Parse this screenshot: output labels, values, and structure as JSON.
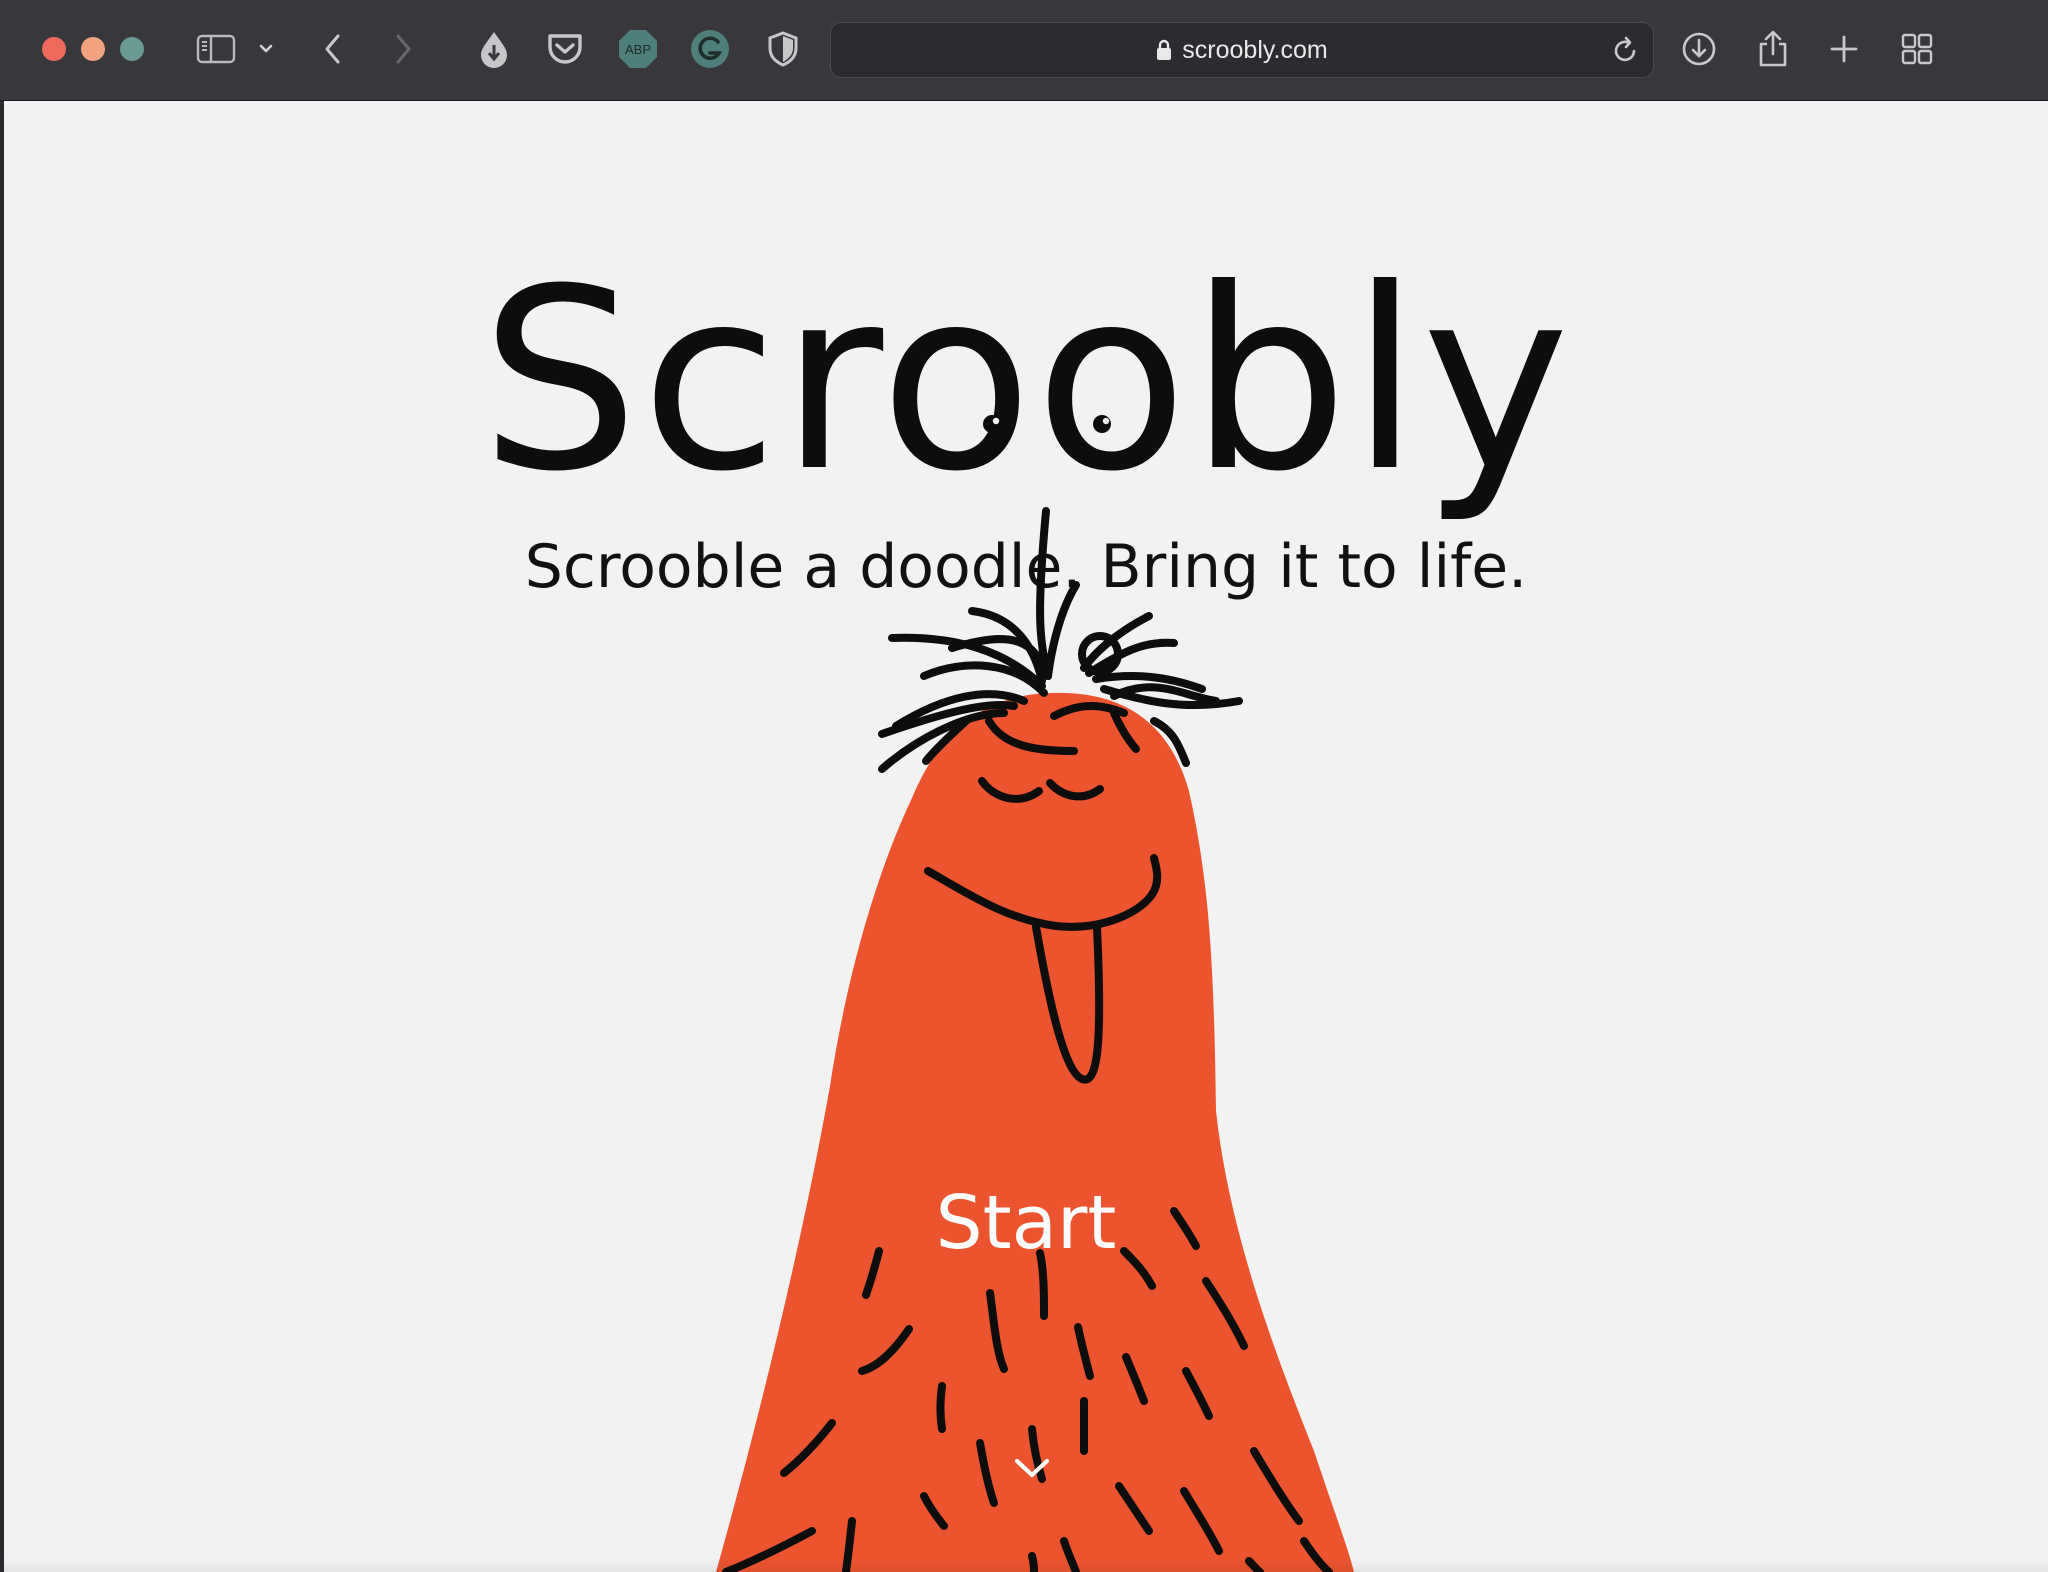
{
  "browser": {
    "url": "scroobly.com",
    "colors": {
      "toolbar": "#38373b",
      "close": "#ee6a5d",
      "minimize": "#f1a27e",
      "maximize": "#6b9a94",
      "extension_teal": "#4f7f7b"
    },
    "extensions": [
      {
        "name": "ink-drop-download-icon"
      },
      {
        "name": "pocket-icon"
      },
      {
        "name": "adblock-plus-icon",
        "label": "ABP"
      },
      {
        "name": "grammarly-icon"
      },
      {
        "name": "privacy-shield-icon"
      }
    ]
  },
  "hero": {
    "title": "Scroobly",
    "subtitle": "Scrooble a doodle. Bring it to life.",
    "start_label": "Start"
  },
  "theme": {
    "page_background": "#f2f2f3",
    "monster_color": "#eb542e",
    "ink": "#0d0d0d"
  }
}
